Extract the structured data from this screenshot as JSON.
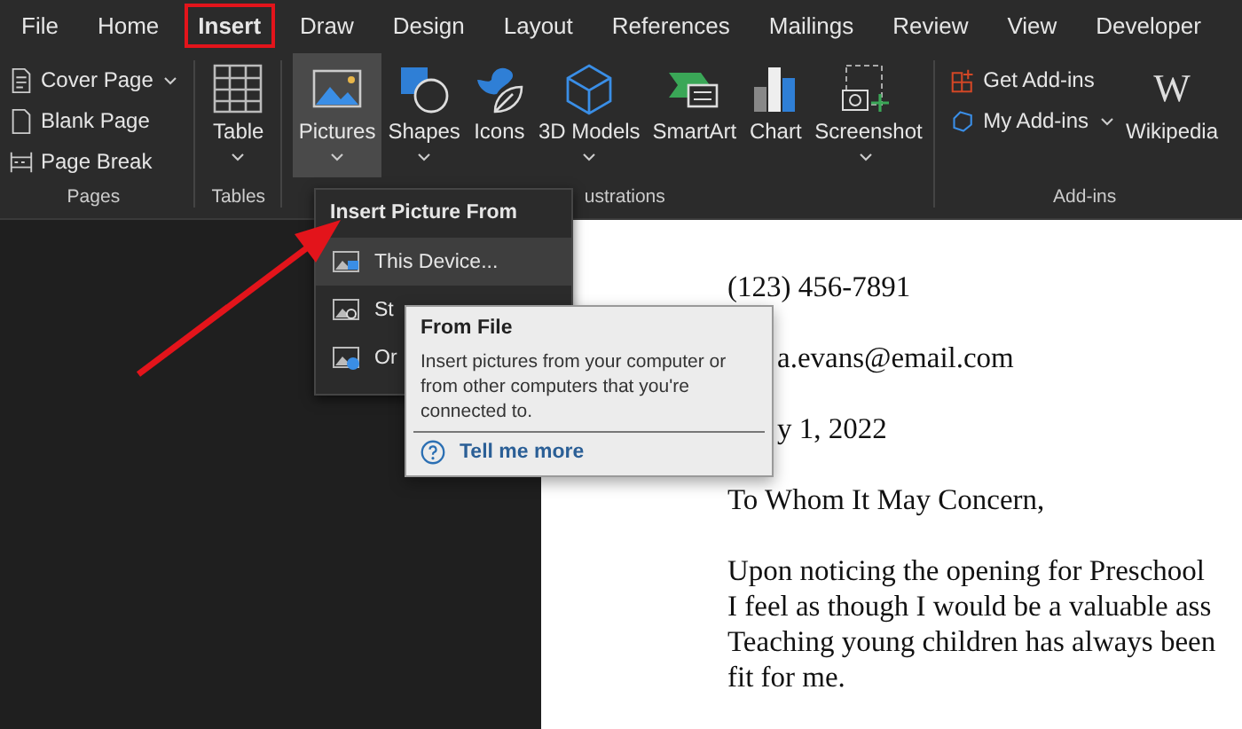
{
  "tabs": [
    {
      "label": "File",
      "selected": false
    },
    {
      "label": "Home",
      "selected": false
    },
    {
      "label": "Insert",
      "selected": true
    },
    {
      "label": "Draw",
      "selected": false
    },
    {
      "label": "Design",
      "selected": false
    },
    {
      "label": "Layout",
      "selected": false
    },
    {
      "label": "References",
      "selected": false
    },
    {
      "label": "Mailings",
      "selected": false
    },
    {
      "label": "Review",
      "selected": false
    },
    {
      "label": "View",
      "selected": false
    },
    {
      "label": "Developer",
      "selected": false
    }
  ],
  "groups": [
    {
      "label": "Pages",
      "items": [
        {
          "kind": "small",
          "label": "Cover Page",
          "dropdown": true,
          "selected": false
        },
        {
          "kind": "small",
          "label": "Blank Page",
          "dropdown": false,
          "selected": false
        },
        {
          "kind": "small",
          "label": "Page Break",
          "dropdown": false,
          "selected": false
        }
      ]
    },
    {
      "label": "Tables",
      "items": [
        {
          "kind": "large",
          "label": "Table",
          "dropdown": true,
          "selected": false
        }
      ]
    },
    {
      "label": "ustrations",
      "items": [
        {
          "kind": "large",
          "label": "Pictures",
          "dropdown": true,
          "selected": true
        },
        {
          "kind": "large",
          "label": "Shapes",
          "dropdown": true,
          "selected": false
        },
        {
          "kind": "large",
          "label": "Icons",
          "dropdown": false,
          "selected": false
        },
        {
          "kind": "large",
          "label": "3D Models",
          "dropdown": true,
          "selected": false
        },
        {
          "kind": "large",
          "label": "SmartArt",
          "dropdown": false,
          "selected": false
        },
        {
          "kind": "large",
          "label": "Chart",
          "dropdown": false,
          "selected": false
        },
        {
          "kind": "large",
          "label": "Screenshot",
          "dropdown": true,
          "selected": false
        }
      ]
    },
    {
      "label": "Add-ins",
      "items": [
        {
          "kind": "small",
          "label": "Get Add-ins",
          "dropdown": false,
          "selected": false
        },
        {
          "kind": "small",
          "label": "My Add-ins",
          "dropdown": true,
          "selected": false
        },
        {
          "kind": "large",
          "label": "Wikipedia",
          "logo": "W",
          "dropdown": false,
          "selected": false
        }
      ]
    }
  ],
  "menu": {
    "title": "Insert Picture From",
    "items": [
      {
        "label": "This Device...",
        "selected": true
      },
      {
        "label": "St",
        "selected": false
      },
      {
        "label": "Or",
        "selected": false
      }
    ]
  },
  "tooltip": {
    "title": "From File",
    "body": "Insert pictures from your computer or from other computers that you're connected to.",
    "link": "Tell me more"
  },
  "document": {
    "lines": [
      {
        "kind": "line",
        "text": "(123) 456-7891"
      },
      {
        "kind": "covered",
        "text": "a.evans@email.com"
      },
      {
        "kind": "covered",
        "text": "y 1, 2022"
      },
      {
        "kind": "line",
        "text": "To Whom It May Concern,"
      },
      {
        "kind": "paragraph",
        "text": "Upon noticing the opening for Preschool"
      },
      {
        "kind": "paragraph",
        "text": "I feel as though I would be a valuable ass"
      },
      {
        "kind": "paragraph",
        "text": "Teaching young children has always been"
      },
      {
        "kind": "paragraph",
        "text": "fit for me."
      }
    ]
  }
}
